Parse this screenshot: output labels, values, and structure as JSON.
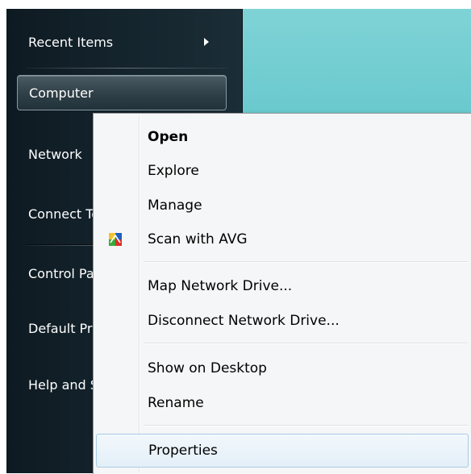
{
  "start_menu": {
    "items": [
      {
        "label": "Recent Items",
        "has_submenu": true
      },
      {
        "label": "Computer",
        "highlighted": true
      },
      {
        "label": "Network"
      },
      {
        "label": "Connect To"
      },
      {
        "label": "Control Panel"
      },
      {
        "label": "Default Programs"
      },
      {
        "label": "Help and Support"
      }
    ]
  },
  "context_menu": {
    "items": [
      {
        "label": "Open",
        "bold": true
      },
      {
        "label": "Explore"
      },
      {
        "label": "Manage"
      },
      {
        "label": "Scan with AVG",
        "icon": "avg-icon"
      },
      {
        "label": "Map Network Drive..."
      },
      {
        "label": "Disconnect Network Drive..."
      },
      {
        "label": "Show on Desktop"
      },
      {
        "label": "Rename"
      },
      {
        "label": "Properties",
        "highlighted": true
      }
    ]
  },
  "colors": {
    "desktop_teal": "#5ec4c9",
    "start_menu_dark": "#15252e",
    "menu_background": "#f5f6f7",
    "menu_highlight_border": "#a9cbe5"
  }
}
